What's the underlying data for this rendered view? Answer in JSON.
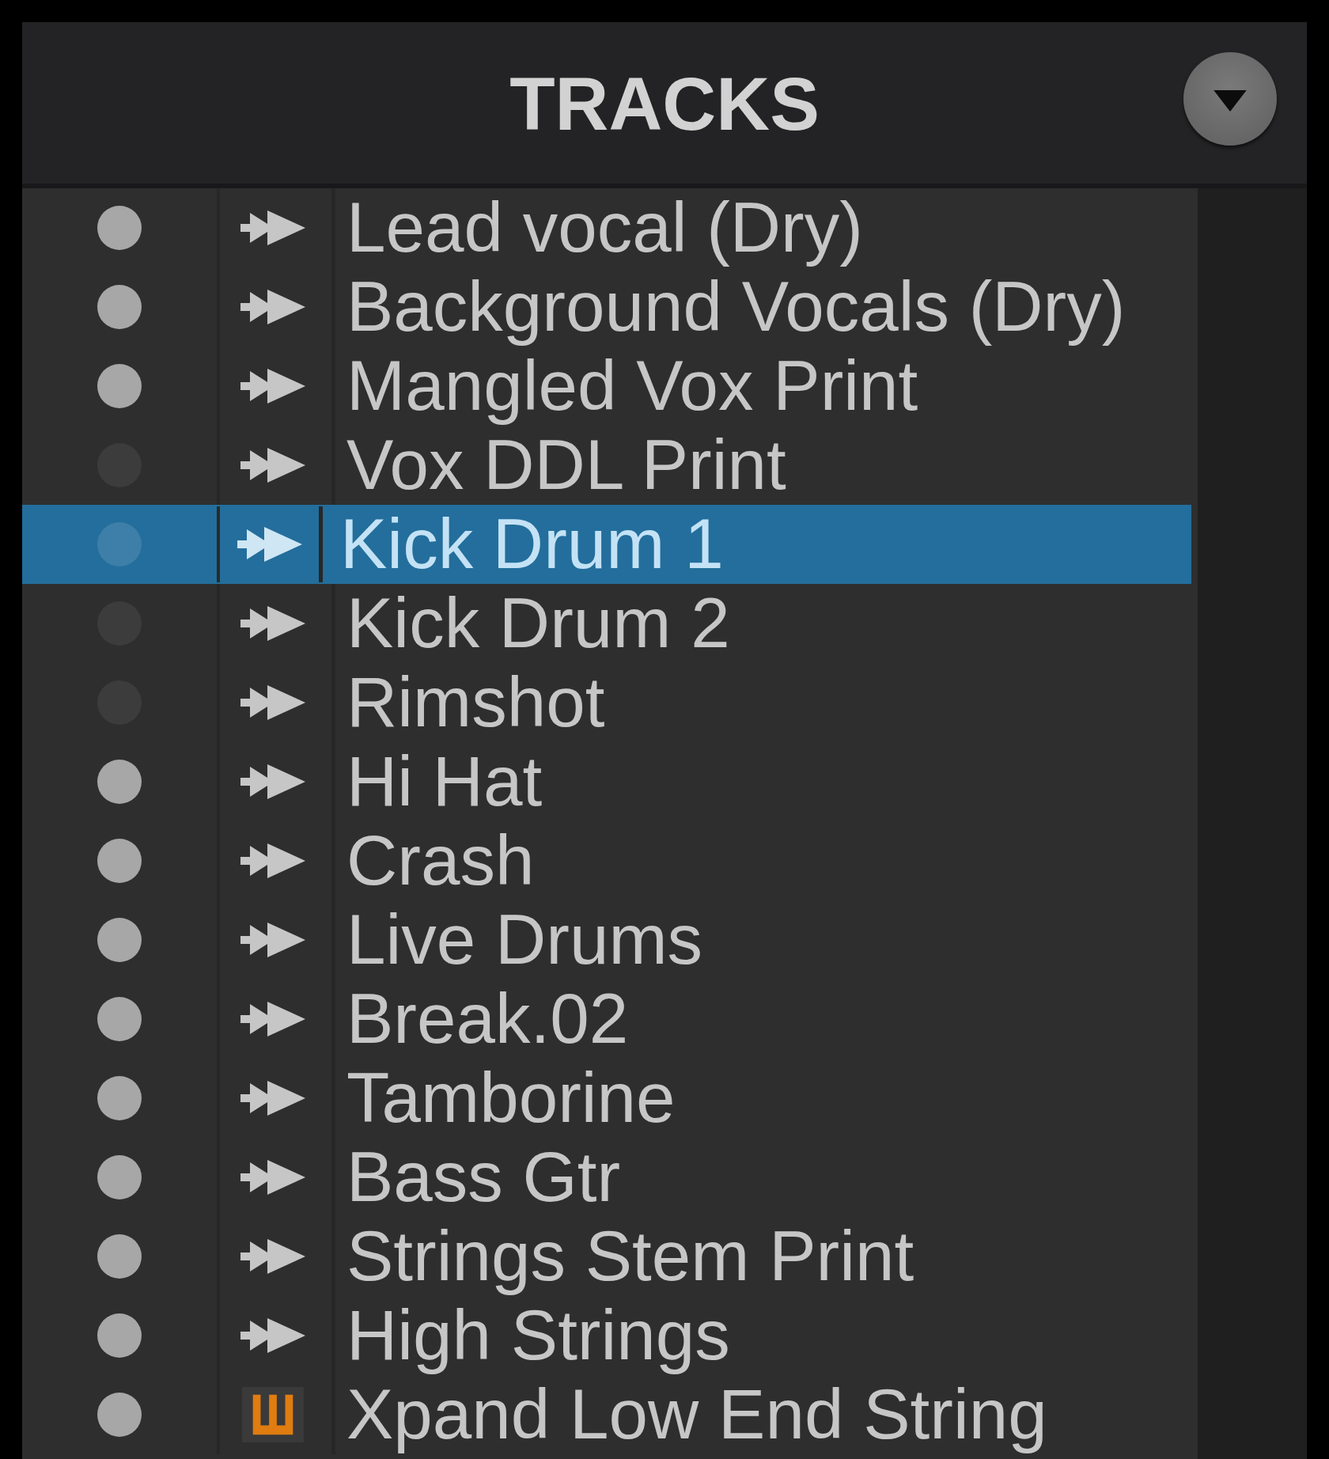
{
  "panel": {
    "title": "TRACKS"
  },
  "tracks": [
    {
      "name": "Lead vocal (Dry)",
      "kind": "audio",
      "active": true,
      "selected": false
    },
    {
      "name": "Background Vocals (Dry)",
      "kind": "audio",
      "active": true,
      "selected": false
    },
    {
      "name": "Mangled Vox Print",
      "kind": "audio",
      "active": true,
      "selected": false
    },
    {
      "name": "Vox DDL Print",
      "kind": "audio",
      "active": false,
      "selected": false
    },
    {
      "name": "Kick Drum 1",
      "kind": "audio",
      "active": false,
      "selected": true
    },
    {
      "name": "Kick Drum 2",
      "kind": "audio",
      "active": false,
      "selected": false
    },
    {
      "name": "Rimshot",
      "kind": "audio",
      "active": false,
      "selected": false
    },
    {
      "name": "Hi Hat",
      "kind": "audio",
      "active": true,
      "selected": false
    },
    {
      "name": "Crash",
      "kind": "audio",
      "active": true,
      "selected": false
    },
    {
      "name": "Live Drums",
      "kind": "audio",
      "active": true,
      "selected": false
    },
    {
      "name": "Break.02",
      "kind": "audio",
      "active": true,
      "selected": false
    },
    {
      "name": "Tamborine",
      "kind": "audio",
      "active": true,
      "selected": false
    },
    {
      "name": "Bass Gtr",
      "kind": "audio",
      "active": true,
      "selected": false
    },
    {
      "name": "Strings Stem Print",
      "kind": "audio",
      "active": true,
      "selected": false
    },
    {
      "name": "High Strings",
      "kind": "audio",
      "active": true,
      "selected": false
    },
    {
      "name": "Xpand Low End String",
      "kind": "instrument",
      "active": true,
      "selected": false
    }
  ]
}
